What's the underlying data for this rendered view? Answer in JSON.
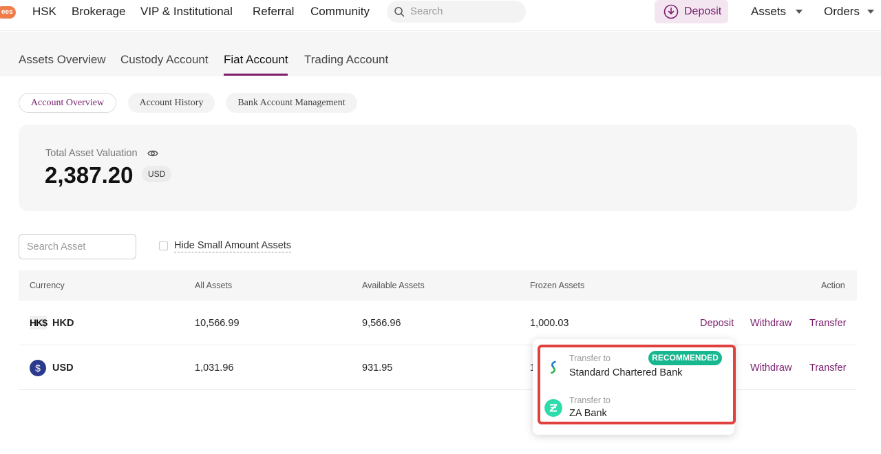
{
  "topnav": {
    "promo_badge": "ees",
    "links": [
      "HSK",
      "Brokerage",
      "VIP & Institutional",
      "Referral",
      "Community"
    ],
    "search_placeholder": "Search",
    "deposit_label": "Deposit",
    "assets_label": "Assets",
    "orders_label": "Orders"
  },
  "tabs": {
    "assets_overview": "Assets Overview",
    "custody_account": "Custody Account",
    "fiat_account": "Fiat Account",
    "trading_account": "Trading Account"
  },
  "subtabs": {
    "account_overview": "Account Overview",
    "account_history": "Account History",
    "bank_account_management": "Bank Account Management"
  },
  "valuation": {
    "label": "Total Asset Valuation",
    "amount": "2,387.20",
    "unit": "USD"
  },
  "filters": {
    "search_placeholder": "Search Asset",
    "hide_small_label": "Hide Small Amount Assets"
  },
  "table": {
    "headers": {
      "currency": "Currency",
      "all_assets": "All Assets",
      "available_assets": "Available Assets",
      "frozen_assets": "Frozen Assets",
      "action": "Action"
    },
    "rows": [
      {
        "icon": "HK$",
        "currency": "HKD",
        "all_assets": "10,566.99",
        "available_assets": "9,566.96",
        "frozen_assets": "1,000.03",
        "deposit": "Deposit",
        "withdraw": "Withdraw",
        "transfer": "Transfer"
      },
      {
        "icon": "$",
        "currency": "USD",
        "all_assets": "1,031.96",
        "available_assets": "931.95",
        "frozen_assets": "1",
        "withdraw": "Withdraw",
        "transfer": "Transfer"
      }
    ]
  },
  "transfer_popup": {
    "options": [
      {
        "kicker": "Transfer to",
        "bank": "Standard Chartered Bank",
        "badge": "RECOMMENDED",
        "icon": "standard-chartered-logo"
      },
      {
        "kicker": "Transfer to",
        "bank": "ZA Bank",
        "icon": "za-bank-logo"
      }
    ]
  },
  "colors": {
    "brand": "#7a1d6e",
    "recommended": "#17b890",
    "highlight": "#e0413f"
  }
}
